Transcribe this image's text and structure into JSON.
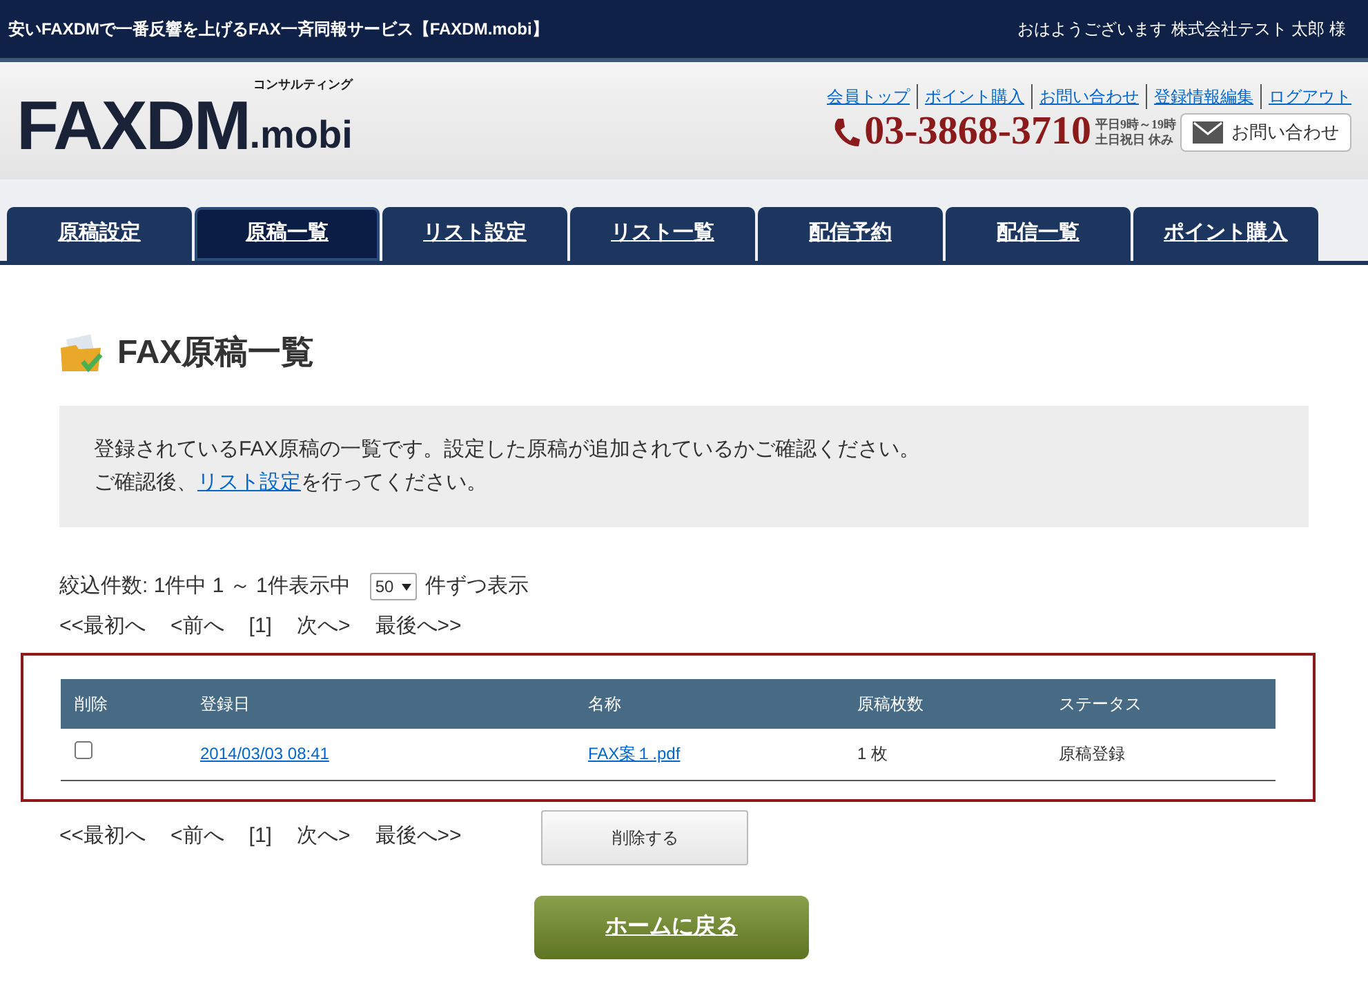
{
  "top_bar": {
    "title": "安いFAXDMで一番反響を上げるFAX一斉同報サービス【FAXDM.mobi】",
    "greeting": "おはようございます 株式会社テスト 太郎 様"
  },
  "header": {
    "logo": "FAXDM",
    "logo_suffix": ".mobi",
    "logo_sub": "コンサルティング",
    "links": [
      "会員トップ",
      "ポイント購入",
      "お問い合わせ",
      "登録情報編集",
      "ログアウト"
    ],
    "phone": "03-3868-3710",
    "hours": [
      "平日9時～19時",
      "土日祝日 休み"
    ],
    "contact_button": "お問い合わせ"
  },
  "tabs": [
    {
      "label": "原稿設定",
      "selected": false
    },
    {
      "label": "原稿一覧",
      "selected": true
    },
    {
      "label": "リスト設定",
      "selected": false
    },
    {
      "label": "リスト一覧",
      "selected": false
    },
    {
      "label": "配信予約",
      "selected": false
    },
    {
      "label": "配信一覧",
      "selected": false
    },
    {
      "label": "ポイント購入",
      "selected": false
    }
  ],
  "page_title": "FAX原稿一覧",
  "info": {
    "line1": "登録されているFAX原稿の一覧です。設定した原稿が追加されているかご確認ください。",
    "line2_before": "ご確認後、",
    "link": "リスト設定",
    "line2_after": "を行ってください。"
  },
  "filter": {
    "count": "絞込件数: 1件中 1 ～ 1件表示中",
    "per_page": "50",
    "per_page_suffix": "件ずつ表示"
  },
  "pager_top": [
    "<<最初へ",
    "<前へ",
    "[1]",
    "次へ>",
    "最後へ>>"
  ],
  "table": {
    "columns": [
      "削除",
      "登録日",
      "名称",
      "原稿枚数",
      "ステータス"
    ],
    "rows": [
      {
        "checked": false,
        "date": "2014/03/03 08:41",
        "name": "FAX案１.pdf",
        "pages": "1 枚",
        "status": "原稿登録"
      }
    ]
  },
  "pager_bottom": [
    "<<最初へ",
    "<前へ",
    "[1]",
    "次へ>",
    "最後へ>>"
  ],
  "delete_button": "削除する",
  "home_button": "ホームに戻る"
}
